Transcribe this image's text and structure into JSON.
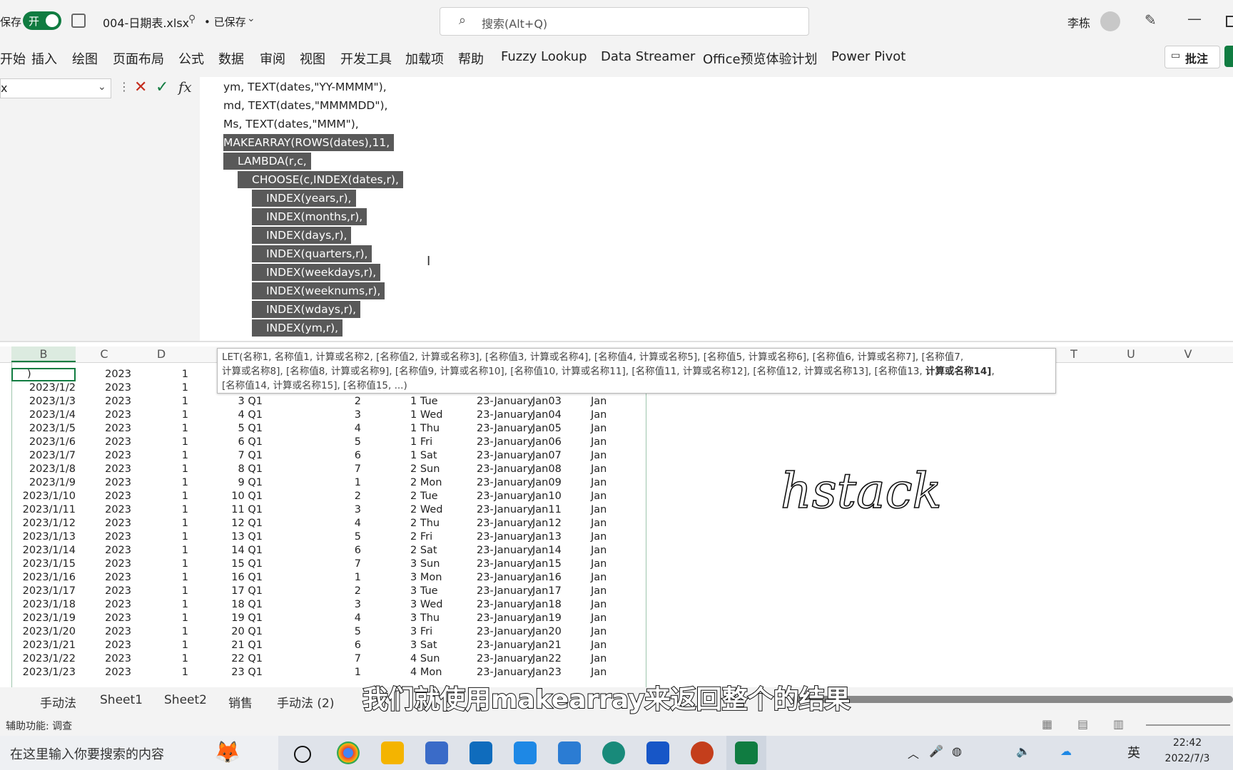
{
  "titlebar": {
    "autosave_label": "保存",
    "toggle_label": "开",
    "filename": "004-日期表.xlsx",
    "save_status": "• 已保存",
    "search_placeholder": "搜索(Alt+Q)",
    "user_name": "李栋"
  },
  "ribbon": {
    "tabs": [
      "开始",
      "插入",
      "绘图",
      "页面布局",
      "公式",
      "数据",
      "审阅",
      "视图",
      "开发工具",
      "加载项",
      "帮助",
      "Fuzzy Lookup",
      "Data Streamer",
      "Office预览体验计划",
      "Power Pivot"
    ],
    "comments_button": "批注"
  },
  "formula_bar": {
    "name_box": "x",
    "fx_label": "fx",
    "lines": [
      {
        "text": "ym, TEXT(dates,\"YY-MMMM\"),",
        "selected": false,
        "indent": 0
      },
      {
        "text": "md, TEXT(dates,\"MMMMDD\"),",
        "selected": false,
        "indent": 0
      },
      {
        "text": "Ms, TEXT(dates,\"MMM\"),",
        "selected": false,
        "indent": 0
      },
      {
        "text": "MAKEARRAY(ROWS(dates),11,",
        "selected": true,
        "indent": 0
      },
      {
        "text": "LAMBDA(r,c,",
        "selected": true,
        "indent": 1
      },
      {
        "text": "CHOOSE(c,INDEX(dates,r),",
        "selected": true,
        "indent": 2
      },
      {
        "text": "INDEX(years,r),",
        "selected": true,
        "indent": 3
      },
      {
        "text": "INDEX(months,r),",
        "selected": true,
        "indent": 3
      },
      {
        "text": "INDEX(days,r),",
        "selected": true,
        "indent": 3
      },
      {
        "text": "INDEX(quarters,r),",
        "selected": true,
        "indent": 3
      },
      {
        "text": "INDEX(weekdays,r),",
        "selected": true,
        "indent": 3
      },
      {
        "text": "INDEX(weeknums,r),",
        "selected": true,
        "indent": 3
      },
      {
        "text": "INDEX(wdays,r),",
        "selected": true,
        "indent": 3
      },
      {
        "text": "INDEX(ym,r),",
        "selected": true,
        "indent": 3
      }
    ]
  },
  "columns": [
    "B",
    "C",
    "D",
    "",
    "T",
    "U",
    "V"
  ],
  "tooltip": {
    "line1": "LET(名称1, 名称值1, 计算或名称2, [名称值2, 计算或名称3], [名称值3, 计算或名称4], [名称值4, 计算或名称5], [名称值5, 计算或名称6], [名称值6, 计算或名称7], [名称值7,",
    "line2a": "计算或名称8], [名称值8, 计算或名称9], [名称值9, 计算或名称10], [名称值10, 计算或名称11], [名称值11, 计算或名称12], [名称值12, 计算或名称13], [名称值13, ",
    "line2b": "计算或名称14]",
    "line2c": ",",
    "line3": "[名称值14, 计算或名称15], [名称值15, ...)"
  },
  "grid": {
    "first_row": {
      "b": ")",
      "c": "2023",
      "d": "1"
    },
    "rows": [
      [
        "2023/1/2",
        "2023",
        "1",
        "",
        "",
        "",
        "",
        "",
        "",
        ""
      ],
      [
        "2023/1/3",
        "2023",
        "1",
        "3 Q1",
        "2",
        "1 Tue",
        "23-January",
        "Jan03",
        "Jan"
      ],
      [
        "2023/1/4",
        "2023",
        "1",
        "4 Q1",
        "3",
        "1 Wed",
        "23-January",
        "Jan04",
        "Jan"
      ],
      [
        "2023/1/5",
        "2023",
        "1",
        "5 Q1",
        "4",
        "1 Thu",
        "23-January",
        "Jan05",
        "Jan"
      ],
      [
        "2023/1/6",
        "2023",
        "1",
        "6 Q1",
        "5",
        "1 Fri",
        "23-January",
        "Jan06",
        "Jan"
      ],
      [
        "2023/1/7",
        "2023",
        "1",
        "7 Q1",
        "6",
        "1 Sat",
        "23-January",
        "Jan07",
        "Jan"
      ],
      [
        "2023/1/8",
        "2023",
        "1",
        "8 Q1",
        "7",
        "2 Sun",
        "23-January",
        "Jan08",
        "Jan"
      ],
      [
        "2023/1/9",
        "2023",
        "1",
        "9 Q1",
        "1",
        "2 Mon",
        "23-January",
        "Jan09",
        "Jan"
      ],
      [
        "2023/1/10",
        "2023",
        "1",
        "10 Q1",
        "2",
        "2 Tue",
        "23-January",
        "Jan10",
        "Jan"
      ],
      [
        "2023/1/11",
        "2023",
        "1",
        "11 Q1",
        "3",
        "2 Wed",
        "23-January",
        "Jan11",
        "Jan"
      ],
      [
        "2023/1/12",
        "2023",
        "1",
        "12 Q1",
        "4",
        "2 Thu",
        "23-January",
        "Jan12",
        "Jan"
      ],
      [
        "2023/1/13",
        "2023",
        "1",
        "13 Q1",
        "5",
        "2 Fri",
        "23-January",
        "Jan13",
        "Jan"
      ],
      [
        "2023/1/14",
        "2023",
        "1",
        "14 Q1",
        "6",
        "2 Sat",
        "23-January",
        "Jan14",
        "Jan"
      ],
      [
        "2023/1/15",
        "2023",
        "1",
        "15 Q1",
        "7",
        "3 Sun",
        "23-January",
        "Jan15",
        "Jan"
      ],
      [
        "2023/1/16",
        "2023",
        "1",
        "16 Q1",
        "1",
        "3 Mon",
        "23-January",
        "Jan16",
        "Jan"
      ],
      [
        "2023/1/17",
        "2023",
        "1",
        "17 Q1",
        "2",
        "3 Tue",
        "23-January",
        "Jan17",
        "Jan"
      ],
      [
        "2023/1/18",
        "2023",
        "1",
        "18 Q1",
        "3",
        "3 Wed",
        "23-January",
        "Jan18",
        "Jan"
      ],
      [
        "2023/1/19",
        "2023",
        "1",
        "19 Q1",
        "4",
        "3 Thu",
        "23-January",
        "Jan19",
        "Jan"
      ],
      [
        "2023/1/20",
        "2023",
        "1",
        "20 Q1",
        "5",
        "3 Fri",
        "23-January",
        "Jan20",
        "Jan"
      ],
      [
        "2023/1/21",
        "2023",
        "1",
        "21 Q1",
        "6",
        "3 Sat",
        "23-January",
        "Jan21",
        "Jan"
      ],
      [
        "2023/1/22",
        "2023",
        "1",
        "22 Q1",
        "7",
        "4 Sun",
        "23-January",
        "Jan22",
        "Jan"
      ],
      [
        "2023/1/23",
        "2023",
        "1",
        "23 Q1",
        "1",
        "4 Mon",
        "23-January",
        "Jan23",
        "Jan"
      ]
    ]
  },
  "handwriting": "hstack",
  "sheet_tabs": [
    "手动法",
    "Sheet1",
    "Sheet2",
    "销售",
    "手动法 (2)"
  ],
  "subtitle": "我们就使用makearray来返回整个的结果",
  "status": {
    "accessibility": "辅助功能: 调查"
  },
  "taskbar": {
    "search_placeholder": "在这里输入你要搜索的内容",
    "ime": "英",
    "time": "22:42",
    "date": "2022/7/3"
  },
  "colors": {
    "excel_green": "#107c41",
    "selection": "#595959"
  }
}
